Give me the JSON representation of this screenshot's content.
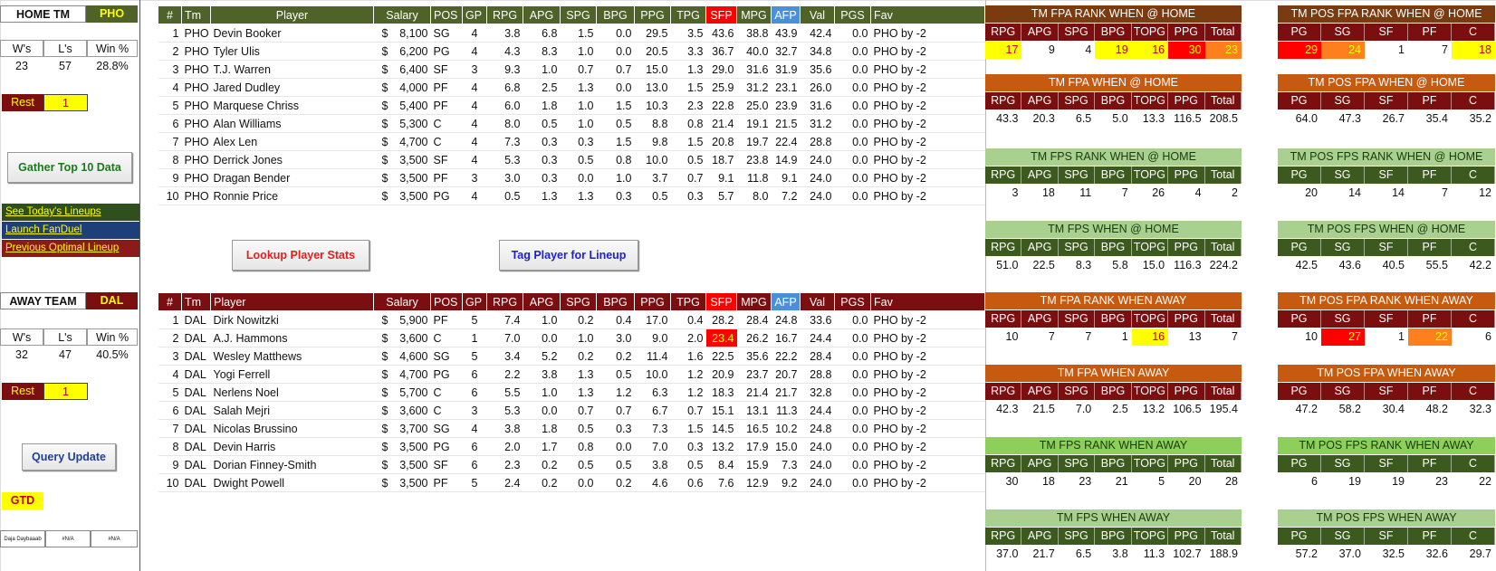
{
  "home": {
    "label": "HOME TM",
    "team": "PHO",
    "w_label": "W's",
    "l_label": "L's",
    "pct_label": "Win %",
    "w": "23",
    "l": "57",
    "pct": "28.8%",
    "rest_label": "Rest",
    "rest": "1"
  },
  "away": {
    "label": "AWAY TEAM",
    "team": "DAL",
    "w_label": "W's",
    "l_label": "L's",
    "pct_label": "Win %",
    "w": "32",
    "l": "47",
    "pct": "40.5%",
    "rest_label": "Rest",
    "rest": "1"
  },
  "buttons": {
    "gather": "Gather Top 10 Data",
    "lookup": "Lookup Player Stats",
    "tag": "Tag Player for Lineup",
    "query": "Query Update"
  },
  "links": {
    "lineups": "See Today's Lineups",
    "fanduel": "Launch FanDuel",
    "optimal": "Previous Optimal Lineup"
  },
  "gtd": "GTD",
  "misc": [
    "Daja Daybaaab",
    "#N/A",
    "#N/A"
  ],
  "columns": [
    "#",
    "Tm",
    "Player",
    "Salary",
    "POS",
    "GP",
    "RPG",
    "APG",
    "SPG",
    "BPG",
    "PPG",
    "TPG",
    "SFP",
    "MPG",
    "AFP",
    "Val",
    "PGS",
    "Fav"
  ],
  "home_players": [
    [
      "1",
      "PHO",
      "Devin Booker",
      "8,100",
      "SG",
      "4",
      "3.8",
      "6.8",
      "1.5",
      "0.0",
      "29.5",
      "3.5",
      "43.6",
      "38.8",
      "43.9",
      "42.4",
      "0.0",
      "PHO by -2"
    ],
    [
      "2",
      "PHO",
      "Tyler Ulis",
      "6,200",
      "PG",
      "4",
      "4.3",
      "8.3",
      "1.0",
      "0.0",
      "20.5",
      "3.3",
      "36.7",
      "40.0",
      "32.7",
      "34.8",
      "0.0",
      "PHO by -2"
    ],
    [
      "3",
      "PHO",
      "T.J. Warren",
      "6,400",
      "SF",
      "3",
      "9.3",
      "1.0",
      "0.7",
      "0.7",
      "15.0",
      "1.3",
      "29.0",
      "31.6",
      "31.9",
      "35.6",
      "0.0",
      "PHO by -2"
    ],
    [
      "4",
      "PHO",
      "Jared Dudley",
      "4,000",
      "PF",
      "4",
      "6.8",
      "2.5",
      "1.3",
      "0.0",
      "13.0",
      "1.5",
      "25.9",
      "31.2",
      "23.1",
      "26.0",
      "0.0",
      "PHO by -2"
    ],
    [
      "5",
      "PHO",
      "Marquese Chriss",
      "5,400",
      "PF",
      "4",
      "6.0",
      "1.8",
      "1.0",
      "1.5",
      "10.3",
      "2.3",
      "22.8",
      "25.0",
      "23.9",
      "31.6",
      "0.0",
      "PHO by -2"
    ],
    [
      "6",
      "PHO",
      "Alan Williams",
      "5,300",
      "C",
      "4",
      "8.0",
      "0.5",
      "1.0",
      "0.5",
      "8.8",
      "0.8",
      "21.4",
      "19.1",
      "21.5",
      "31.2",
      "0.0",
      "PHO by -2"
    ],
    [
      "7",
      "PHO",
      "Alex Len",
      "4,700",
      "C",
      "4",
      "7.3",
      "0.3",
      "0.3",
      "1.5",
      "9.8",
      "1.5",
      "20.8",
      "19.7",
      "22.4",
      "28.8",
      "0.0",
      "PHO by -2"
    ],
    [
      "8",
      "PHO",
      "Derrick Jones",
      "3,500",
      "SF",
      "4",
      "5.3",
      "0.3",
      "0.5",
      "0.8",
      "10.0",
      "0.5",
      "18.7",
      "23.8",
      "14.9",
      "24.0",
      "0.0",
      "PHO by -2"
    ],
    [
      "9",
      "PHO",
      "Dragan Bender",
      "3,500",
      "PF",
      "3",
      "3.0",
      "0.3",
      "0.0",
      "1.0",
      "3.7",
      "0.7",
      "9.1",
      "11.8",
      "9.1",
      "24.0",
      "0.0",
      "PHO by -2"
    ],
    [
      "10",
      "PHO",
      "Ronnie Price",
      "3,500",
      "PG",
      "4",
      "0.5",
      "1.3",
      "1.3",
      "0.3",
      "0.5",
      "0.3",
      "5.7",
      "8.0",
      "7.2",
      "24.0",
      "0.0",
      "PHO by -2"
    ]
  ],
  "away_players": [
    [
      "1",
      "DAL",
      "Dirk Nowitzki",
      "5,900",
      "PF",
      "5",
      "7.4",
      "1.0",
      "0.2",
      "0.4",
      "17.0",
      "0.4",
      "28.2",
      "28.4",
      "24.8",
      "33.6",
      "0.0",
      "PHO by -2"
    ],
    [
      "2",
      "DAL",
      "A.J. Hammons",
      "3,600",
      "C",
      "1",
      "7.0",
      "0.0",
      "1.0",
      "3.0",
      "9.0",
      "2.0",
      "23.4",
      "26.2",
      "16.7",
      "24.4",
      "0.0",
      "PHO by -2"
    ],
    [
      "3",
      "DAL",
      "Wesley Matthews",
      "4,600",
      "SG",
      "5",
      "3.4",
      "5.2",
      "0.2",
      "0.2",
      "11.4",
      "1.6",
      "22.5",
      "35.6",
      "22.2",
      "28.4",
      "0.0",
      "PHO by -2"
    ],
    [
      "4",
      "DAL",
      "Yogi Ferrell",
      "4,700",
      "PG",
      "6",
      "2.2",
      "3.8",
      "1.3",
      "0.5",
      "10.0",
      "1.2",
      "20.9",
      "23.7",
      "20.7",
      "28.8",
      "0.0",
      "PHO by -2"
    ],
    [
      "5",
      "DAL",
      "Nerlens Noel",
      "5,700",
      "C",
      "6",
      "5.5",
      "1.0",
      "1.3",
      "1.2",
      "6.3",
      "1.2",
      "18.3",
      "21.4",
      "21.7",
      "32.8",
      "0.0",
      "PHO by -2"
    ],
    [
      "6",
      "DAL",
      "Salah Mejri",
      "3,600",
      "C",
      "3",
      "5.3",
      "0.0",
      "0.7",
      "0.7",
      "6.7",
      "0.7",
      "15.1",
      "13.1",
      "11.3",
      "24.4",
      "0.0",
      "PHO by -2"
    ],
    [
      "7",
      "DAL",
      "Nicolas Brussino",
      "3,700",
      "SG",
      "4",
      "3.8",
      "1.8",
      "0.5",
      "0.3",
      "7.3",
      "1.5",
      "14.5",
      "16.5",
      "10.2",
      "24.8",
      "0.0",
      "PHO by -2"
    ],
    [
      "8",
      "DAL",
      "Devin Harris",
      "3,500",
      "PG",
      "6",
      "2.0",
      "1.7",
      "0.8",
      "0.0",
      "7.0",
      "0.3",
      "13.2",
      "17.9",
      "15.0",
      "24.0",
      "0.0",
      "PHO by -2"
    ],
    [
      "9",
      "DAL",
      "Dorian Finney-Smith",
      "3,500",
      "SF",
      "6",
      "2.3",
      "0.2",
      "0.5",
      "0.5",
      "3.8",
      "0.5",
      "8.4",
      "15.9",
      "7.3",
      "24.0",
      "0.0",
      "PHO by -2"
    ],
    [
      "10",
      "DAL",
      "Dwight Powell",
      "3,500",
      "PF",
      "5",
      "2.4",
      "0.2",
      "0.0",
      "0.2",
      "4.6",
      "0.6",
      "7.6",
      "12.9",
      "9.2",
      "24.0",
      "0.0",
      "PHO by -2"
    ]
  ],
  "team_cols": [
    "RPG",
    "APG",
    "SPG",
    "BPG",
    "TOPG",
    "PPG",
    "Total"
  ],
  "pos_cols": [
    "PG",
    "SG",
    "SF",
    "PF",
    "C"
  ],
  "panels": [
    {
      "title": "TM FPA RANK WHEN @ HOME",
      "values": [
        "17",
        "9",
        "4",
        "19",
        "16",
        "30",
        "23"
      ]
    },
    {
      "title": "TM POS FPA RANK WHEN @ HOME",
      "values": [
        "29",
        "24",
        "1",
        "7",
        "18"
      ]
    },
    {
      "title": "TM FPA WHEN @ HOME",
      "values": [
        "43.3",
        "20.3",
        "6.5",
        "5.0",
        "13.3",
        "116.5",
        "208.5"
      ]
    },
    {
      "title": "TM POS FPA WHEN @ HOME",
      "values": [
        "64.0",
        "47.3",
        "26.7",
        "35.4",
        "35.2"
      ]
    },
    {
      "title": "TM FPS RANK WHEN @ HOME",
      "values": [
        "3",
        "18",
        "11",
        "7",
        "26",
        "4",
        "2"
      ]
    },
    {
      "title": "TM POS FPS RANK WHEN @ HOME",
      "values": [
        "20",
        "14",
        "14",
        "7",
        "12"
      ]
    },
    {
      "title": "TM FPS WHEN @ HOME",
      "values": [
        "51.0",
        "22.5",
        "8.3",
        "5.8",
        "15.0",
        "116.3",
        "224.2"
      ]
    },
    {
      "title": "TM POS FPS WHEN @ HOME",
      "values": [
        "42.5",
        "43.6",
        "40.5",
        "55.5",
        "42.2"
      ]
    },
    {
      "title": "TM FPA RANK WHEN AWAY",
      "values": [
        "10",
        "7",
        "7",
        "1",
        "16",
        "13",
        "7"
      ]
    },
    {
      "title": "TM POS FPA RANK WHEN AWAY",
      "values": [
        "10",
        "27",
        "1",
        "22",
        "6"
      ]
    },
    {
      "title": "TM FPA WHEN AWAY",
      "values": [
        "42.3",
        "21.5",
        "7.0",
        "2.5",
        "13.2",
        "106.5",
        "195.4"
      ]
    },
    {
      "title": "TM POS FPA WHEN AWAY",
      "values": [
        "47.2",
        "58.2",
        "30.4",
        "48.2",
        "32.3"
      ]
    },
    {
      "title": "TM FPS RANK WHEN AWAY",
      "values": [
        "30",
        "18",
        "23",
        "21",
        "5",
        "20",
        "28"
      ]
    },
    {
      "title": "TM POS FPS RANK WHEN AWAY",
      "values": [
        "6",
        "19",
        "19",
        "23",
        "22"
      ]
    },
    {
      "title": "TM FPS WHEN AWAY",
      "values": [
        "37.0",
        "21.7",
        "6.5",
        "3.8",
        "11.3",
        "102.7",
        "188.9"
      ]
    },
    {
      "title": "TM POS FPS WHEN AWAY",
      "values": [
        "57.2",
        "37.0",
        "32.5",
        "32.6",
        "29.7"
      ]
    }
  ],
  "colors": {
    "header_home": "#4f6228",
    "header_away": "#7b0f0f",
    "gold": "#c9a22a",
    "yellow": "#ffff00",
    "red": "#ff0000",
    "orange": "#fd7f1e",
    "fpa_rank": "#7a3b10",
    "fpa": "#c65a11",
    "fps_rank": "#a9d08e",
    "fps": "#8ccf5b",
    "sub_dark": "#3d5a1e",
    "sub_red": "#7b0f0f",
    "afp": "#4a90d9",
    "link_green": "#2f4f1c",
    "link_blue": "#1f3f7a",
    "link_red": "#8b1a1a"
  }
}
